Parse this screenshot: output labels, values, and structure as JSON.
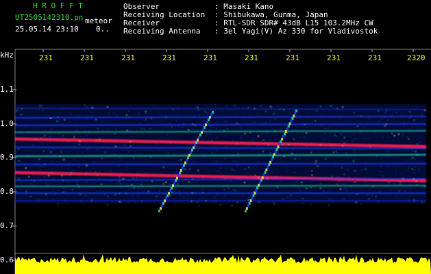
{
  "title": "H R O F F T",
  "file": {
    "name": "UT2505142310.pn",
    "tag": "meteor",
    "datetime": "25.05.14 23:10",
    "extra": "0.."
  },
  "info": [
    {
      "label": "Observer",
      "value": ": Masaki Kano"
    },
    {
      "label": "Receiving Location",
      "value": ": Shibukawa, Gunma, Japan"
    },
    {
      "label": "Receiver",
      "value": ": RTL-SDR SDR# 43dB L15 103.2MHz CW"
    },
    {
      "label": "Receiving Antenna",
      "value": ": 3el Yagi(V) Az 330 for Vladivostok"
    }
  ],
  "axis": {
    "unit": "kHz",
    "y_ticks": [
      "1.1",
      "1.0",
      "0.9",
      "0.8",
      "0.7",
      "0.6"
    ],
    "x_ticks": [
      "231",
      "231",
      "231",
      "231",
      "231",
      "231",
      "231",
      "231",
      "231",
      "2320"
    ]
  },
  "colors": {
    "background": "#000000",
    "text": "#ffffff",
    "title": "#33dd33",
    "axis_ticks": "#ffff22",
    "signal_low": "#1a3cff",
    "signal_mid": "#20e0c0",
    "signal_high": "#ff2050",
    "noise_floor": "#ffff00"
  }
}
